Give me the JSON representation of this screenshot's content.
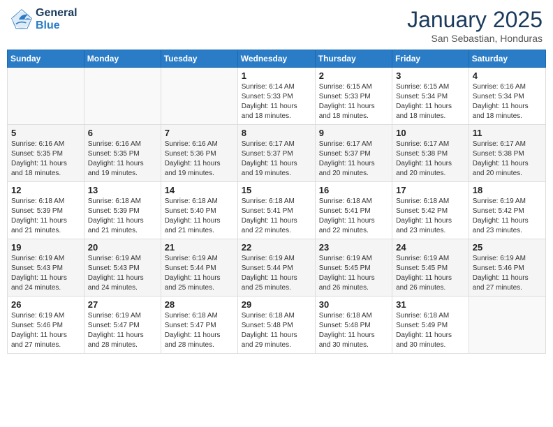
{
  "header": {
    "logo_line1": "General",
    "logo_line2": "Blue",
    "month": "January 2025",
    "location": "San Sebastian, Honduras"
  },
  "days_of_week": [
    "Sunday",
    "Monday",
    "Tuesday",
    "Wednesday",
    "Thursday",
    "Friday",
    "Saturday"
  ],
  "weeks": [
    [
      {
        "day": "",
        "info": ""
      },
      {
        "day": "",
        "info": ""
      },
      {
        "day": "",
        "info": ""
      },
      {
        "day": "1",
        "info": "Sunrise: 6:14 AM\nSunset: 5:33 PM\nDaylight: 11 hours\nand 18 minutes."
      },
      {
        "day": "2",
        "info": "Sunrise: 6:15 AM\nSunset: 5:33 PM\nDaylight: 11 hours\nand 18 minutes."
      },
      {
        "day": "3",
        "info": "Sunrise: 6:15 AM\nSunset: 5:34 PM\nDaylight: 11 hours\nand 18 minutes."
      },
      {
        "day": "4",
        "info": "Sunrise: 6:16 AM\nSunset: 5:34 PM\nDaylight: 11 hours\nand 18 minutes."
      }
    ],
    [
      {
        "day": "5",
        "info": "Sunrise: 6:16 AM\nSunset: 5:35 PM\nDaylight: 11 hours\nand 18 minutes."
      },
      {
        "day": "6",
        "info": "Sunrise: 6:16 AM\nSunset: 5:35 PM\nDaylight: 11 hours\nand 19 minutes."
      },
      {
        "day": "7",
        "info": "Sunrise: 6:16 AM\nSunset: 5:36 PM\nDaylight: 11 hours\nand 19 minutes."
      },
      {
        "day": "8",
        "info": "Sunrise: 6:17 AM\nSunset: 5:37 PM\nDaylight: 11 hours\nand 19 minutes."
      },
      {
        "day": "9",
        "info": "Sunrise: 6:17 AM\nSunset: 5:37 PM\nDaylight: 11 hours\nand 20 minutes."
      },
      {
        "day": "10",
        "info": "Sunrise: 6:17 AM\nSunset: 5:38 PM\nDaylight: 11 hours\nand 20 minutes."
      },
      {
        "day": "11",
        "info": "Sunrise: 6:17 AM\nSunset: 5:38 PM\nDaylight: 11 hours\nand 20 minutes."
      }
    ],
    [
      {
        "day": "12",
        "info": "Sunrise: 6:18 AM\nSunset: 5:39 PM\nDaylight: 11 hours\nand 21 minutes."
      },
      {
        "day": "13",
        "info": "Sunrise: 6:18 AM\nSunset: 5:39 PM\nDaylight: 11 hours\nand 21 minutes."
      },
      {
        "day": "14",
        "info": "Sunrise: 6:18 AM\nSunset: 5:40 PM\nDaylight: 11 hours\nand 21 minutes."
      },
      {
        "day": "15",
        "info": "Sunrise: 6:18 AM\nSunset: 5:41 PM\nDaylight: 11 hours\nand 22 minutes."
      },
      {
        "day": "16",
        "info": "Sunrise: 6:18 AM\nSunset: 5:41 PM\nDaylight: 11 hours\nand 22 minutes."
      },
      {
        "day": "17",
        "info": "Sunrise: 6:18 AM\nSunset: 5:42 PM\nDaylight: 11 hours\nand 23 minutes."
      },
      {
        "day": "18",
        "info": "Sunrise: 6:19 AM\nSunset: 5:42 PM\nDaylight: 11 hours\nand 23 minutes."
      }
    ],
    [
      {
        "day": "19",
        "info": "Sunrise: 6:19 AM\nSunset: 5:43 PM\nDaylight: 11 hours\nand 24 minutes."
      },
      {
        "day": "20",
        "info": "Sunrise: 6:19 AM\nSunset: 5:43 PM\nDaylight: 11 hours\nand 24 minutes."
      },
      {
        "day": "21",
        "info": "Sunrise: 6:19 AM\nSunset: 5:44 PM\nDaylight: 11 hours\nand 25 minutes."
      },
      {
        "day": "22",
        "info": "Sunrise: 6:19 AM\nSunset: 5:44 PM\nDaylight: 11 hours\nand 25 minutes."
      },
      {
        "day": "23",
        "info": "Sunrise: 6:19 AM\nSunset: 5:45 PM\nDaylight: 11 hours\nand 26 minutes."
      },
      {
        "day": "24",
        "info": "Sunrise: 6:19 AM\nSunset: 5:45 PM\nDaylight: 11 hours\nand 26 minutes."
      },
      {
        "day": "25",
        "info": "Sunrise: 6:19 AM\nSunset: 5:46 PM\nDaylight: 11 hours\nand 27 minutes."
      }
    ],
    [
      {
        "day": "26",
        "info": "Sunrise: 6:19 AM\nSunset: 5:46 PM\nDaylight: 11 hours\nand 27 minutes."
      },
      {
        "day": "27",
        "info": "Sunrise: 6:19 AM\nSunset: 5:47 PM\nDaylight: 11 hours\nand 28 minutes."
      },
      {
        "day": "28",
        "info": "Sunrise: 6:18 AM\nSunset: 5:47 PM\nDaylight: 11 hours\nand 28 minutes."
      },
      {
        "day": "29",
        "info": "Sunrise: 6:18 AM\nSunset: 5:48 PM\nDaylight: 11 hours\nand 29 minutes."
      },
      {
        "day": "30",
        "info": "Sunrise: 6:18 AM\nSunset: 5:48 PM\nDaylight: 11 hours\nand 30 minutes."
      },
      {
        "day": "31",
        "info": "Sunrise: 6:18 AM\nSunset: 5:49 PM\nDaylight: 11 hours\nand 30 minutes."
      },
      {
        "day": "",
        "info": ""
      }
    ]
  ]
}
